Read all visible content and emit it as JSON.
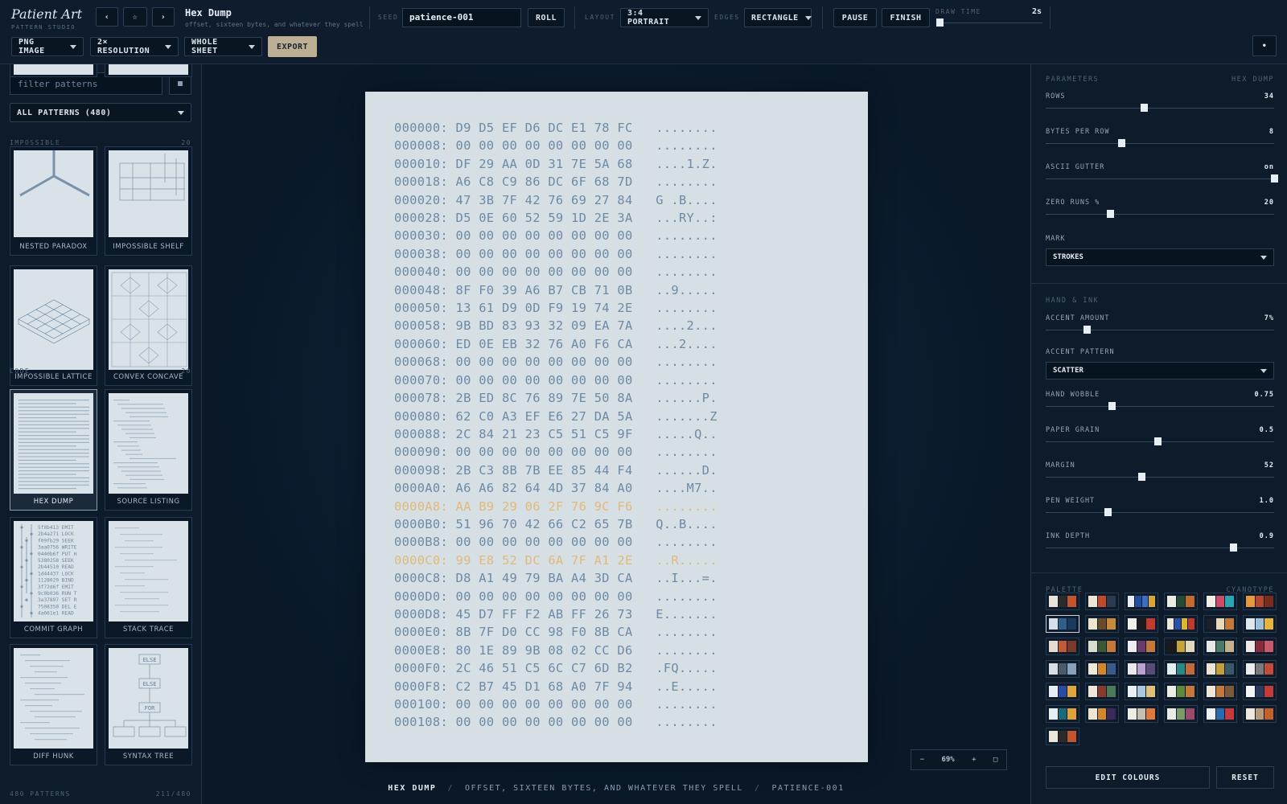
{
  "app": {
    "title": "Patient Art",
    "subtitle": "PATTERN STUDIO"
  },
  "toolbar": {
    "prev": "‹",
    "star": "☆",
    "next": "›",
    "pattern_title": "Hex Dump",
    "pattern_desc": "offset, sixteen bytes, and whatever they spell",
    "seed_label": "SEED",
    "seed_value": "patience-001",
    "roll": "ROLL",
    "layout_label": "LAYOUT",
    "layout_value": "3:4 PORTRAIT",
    "edges_label": "EDGES",
    "edges_value": "RECTANGLE",
    "pause": "PAUSE",
    "finish": "FINISH",
    "draw_time_label": "DRAW TIME",
    "draw_time_value": "2s",
    "draw_time_fraction": 0.02,
    "format": "PNG IMAGE",
    "resolution": "2× RESOLUTION",
    "scope": "WHOLE SHEET",
    "export": "EXPORT",
    "dot": "•"
  },
  "sidebar": {
    "filter_placeholder": "filter patterns",
    "filter_button_icon": "square-icon",
    "category": "ALL PATTERNS (480)",
    "sections": [
      {
        "name": "IMPOSSIBLE",
        "count": "20"
      },
      {
        "name": "CODE",
        "count": "20"
      }
    ],
    "thumbs": [
      {
        "label": "NESTED PARADOX"
      },
      {
        "label": "IMPOSSIBLE SHELF"
      },
      {
        "label": "IMPOSSIBLE LATTICE"
      },
      {
        "label": "CONVEX CONCAVE"
      },
      {
        "label": "HEX DUMP"
      },
      {
        "label": "SOURCE LISTING"
      },
      {
        "label": "COMMIT GRAPH"
      },
      {
        "label": "STACK TRACE"
      },
      {
        "label": "DIFF HUNK"
      },
      {
        "label": "SYNTAX TREE"
      }
    ],
    "commit_lines": [
      "5f0b413 EMIT",
      "2b4a271 LOCK",
      "f09fb29 SEEK",
      "3aa0756 WRITE",
      "0440b6f PUT H",
      "5380258 SEEK",
      "2b44510 READ",
      "1d44437 LOCK",
      "1128029 BIND",
      "3f72d6f EMIT",
      "9c0b036 RUN T",
      "3a37897 SET R",
      "7508350 DEL E",
      "4a661e1 READ"
    ],
    "tree_nodes": [
      "ELSE",
      "ELSE",
      "FOR"
    ],
    "footer_left": "480 PATTERNS",
    "footer_right": "211/480"
  },
  "hexdump": {
    "rows": [
      {
        "off": "000000:",
        "bytes": "D9 D5 EF D6 DC E1 78 FC",
        "ascii": "........"
      },
      {
        "off": "000008:",
        "bytes": "00 00 00 00 00 00 00 00",
        "ascii": "........"
      },
      {
        "off": "000010:",
        "bytes": "DF 29 AA 0D 31 7E 5A 68",
        "ascii": "....1.Z."
      },
      {
        "off": "000018:",
        "bytes": "A6 C8 C9 86 DC 6F 68 7D",
        "ascii": "........"
      },
      {
        "off": "000020:",
        "bytes": "47 3B 7F 42 76 69 27 84",
        "ascii": "G .B...."
      },
      {
        "off": "000028:",
        "bytes": "D5 0E 60 52 59 1D 2E 3A",
        "ascii": "...RY..:"
      },
      {
        "off": "000030:",
        "bytes": "00 00 00 00 00 00 00 00",
        "ascii": "........"
      },
      {
        "off": "000038:",
        "bytes": "00 00 00 00 00 00 00 00",
        "ascii": "........"
      },
      {
        "off": "000040:",
        "bytes": "00 00 00 00 00 00 00 00",
        "ascii": "........"
      },
      {
        "off": "000048:",
        "bytes": "8F F0 39 A6 B7 CB 71 0B",
        "ascii": "..9....."
      },
      {
        "off": "000050:",
        "bytes": "13 61 D9 0D F9 19 74 2E",
        "ascii": "........"
      },
      {
        "off": "000058:",
        "bytes": "9B BD 83 93 32 09 EA 7A",
        "ascii": "....2..."
      },
      {
        "off": "000060:",
        "bytes": "ED 0E EB 32 76 A0 F6 CA",
        "ascii": "...2...."
      },
      {
        "off": "000068:",
        "bytes": "00 00 00 00 00 00 00 00",
        "ascii": "........"
      },
      {
        "off": "000070:",
        "bytes": "00 00 00 00 00 00 00 00",
        "ascii": "........"
      },
      {
        "off": "000078:",
        "bytes": "2B ED 8C 76 89 7E 50 8A",
        "ascii": "......P."
      },
      {
        "off": "000080:",
        "bytes": "62 C0 A3 EF E6 27 DA 5A",
        "ascii": ".......Z"
      },
      {
        "off": "000088:",
        "bytes": "2C 84 21 23 C5 51 C5 9F",
        "ascii": ".....Q.."
      },
      {
        "off": "000090:",
        "bytes": "00 00 00 00 00 00 00 00",
        "ascii": "........"
      },
      {
        "off": "000098:",
        "bytes": "2B C3 8B 7B EE 85 44 F4",
        "ascii": "......D."
      },
      {
        "off": "0000A0:",
        "bytes": "A6 A6 82 64 4D 37 84 A0",
        "ascii": "....M7.."
      },
      {
        "off": "0000A8:",
        "bytes": "AA B9 29 06 2F 76 9C F6",
        "ascii": "........",
        "accent": true
      },
      {
        "off": "0000B0:",
        "bytes": "51 96 70 42 66 C2 65 7B",
        "ascii": "Q..B...."
      },
      {
        "off": "0000B8:",
        "bytes": "00 00 00 00 00 00 00 00",
        "ascii": "........"
      },
      {
        "off": "0000C0:",
        "bytes": "99 E8 52 DC 6A 7F A1 2E",
        "ascii": "..R.....",
        "accent": true
      },
      {
        "off": "0000C8:",
        "bytes": "D8 A1 49 79 BA A4 3D CA",
        "ascii": "..I...=."
      },
      {
        "off": "0000D0:",
        "bytes": "00 00 00 00 00 00 00 00",
        "ascii": "........"
      },
      {
        "off": "0000D8:",
        "bytes": "45 D7 FF F2 AB FF 26 73",
        "ascii": "E......."
      },
      {
        "off": "0000E0:",
        "bytes": "8B 7F D0 CC 98 F0 8B CA",
        "ascii": "........"
      },
      {
        "off": "0000E8:",
        "bytes": "80 1E 89 9B 08 02 CC D6",
        "ascii": "........"
      },
      {
        "off": "0000F0:",
        "bytes": "2C 46 51 C5 6C C7 6D B2",
        "ascii": ".FQ....."
      },
      {
        "off": "0000F8:",
        "bytes": "C2 B7 45 D1 68 A0 7F 94",
        "ascii": "..E....."
      },
      {
        "off": "000100:",
        "bytes": "00 00 00 00 00 00 00 00",
        "ascii": "........"
      },
      {
        "off": "000108:",
        "bytes": "00 00 00 00 00 00 00 00",
        "ascii": "........"
      }
    ]
  },
  "canvas": {
    "zoom_minus": "−",
    "zoom_value": "69%",
    "zoom_plus": "+",
    "fit_icon": "□",
    "caption_title": "HEX DUMP",
    "caption_desc": "OFFSET, SIXTEEN BYTES, AND WHATEVER THEY SPELL",
    "caption_seed": "PATIENCE-001",
    "sep": "/"
  },
  "params": {
    "section_title": "PARAMETERS",
    "section_name": "HEX DUMP",
    "items": [
      {
        "label": "ROWS",
        "value": "34",
        "fraction": 0.43
      },
      {
        "label": "BYTES PER ROW",
        "value": "8",
        "fraction": 0.33
      },
      {
        "label": "ASCII GUTTER",
        "value": "on",
        "fraction": 1.0
      },
      {
        "label": "ZERO RUNS %",
        "value": "20",
        "fraction": 0.28
      }
    ],
    "mark_label": "MARK",
    "mark_value": "STROKES",
    "hand_title": "HAND & INK",
    "accent_amount": {
      "label": "ACCENT AMOUNT",
      "value": "7%",
      "fraction": 0.18
    },
    "accent_pattern_label": "ACCENT PATTERN",
    "accent_pattern_value": "SCATTER",
    "items2": [
      {
        "label": "HAND WOBBLE",
        "value": "0.75",
        "fraction": 0.29
      },
      {
        "label": "PAPER GRAIN",
        "value": "0.5",
        "fraction": 0.49
      },
      {
        "label": "MARGIN",
        "value": "52",
        "fraction": 0.42
      },
      {
        "label": "PEN WEIGHT",
        "value": "1.0",
        "fraction": 0.27
      },
      {
        "label": "INK DEPTH",
        "value": "0.9",
        "fraction": 0.82
      }
    ]
  },
  "palette": {
    "title": "PALETTE",
    "name": "CYANOTYPE",
    "edit": "EDIT COLOURS",
    "reset": "RESET",
    "swatches": [
      [
        "#e8e4da",
        "#2a2a2a",
        "#c2552b"
      ],
      [
        "#efe6d4",
        "#c24a2a",
        "#2b3b52"
      ],
      [
        "#e8eef3",
        "#1f4fa0",
        "#3c6fc4",
        "#d9a53a"
      ],
      [
        "#ecebe4",
        "#234b34",
        "#c46a2e"
      ],
      [
        "#f1eee6",
        "#d04a6a",
        "#2aa6b0"
      ],
      [
        "#e49a3a",
        "#b8462a",
        "#7a2d1c"
      ],
      [
        "#d6e0ea",
        "#2f5f8a",
        "#1a3a5c"
      ],
      [
        "#efe6d0",
        "#6b4a2a",
        "#c7893a"
      ],
      [
        "#f3f0ea",
        "#1b1b1b",
        "#c23b2e"
      ],
      [
        "#ede8dc",
        "#2c52a8",
        "#e0b92a",
        "#c43a2a"
      ],
      [
        "#1d2028",
        "#e8d9b8",
        "#c4793a"
      ],
      [
        "#dfe8ef",
        "#9dc1dd",
        "#e8b440"
      ],
      [
        "#e7dccd",
        "#c25a3a",
        "#7a3a2a"
      ],
      [
        "#d9dfd0",
        "#3b5a34",
        "#c4793a"
      ],
      [
        "#f0ecef",
        "#6a3a6a",
        "#c4793a"
      ],
      [
        "#1a1a1a",
        "#c7a33a",
        "#e0d9c0"
      ],
      [
        "#e6ebe6",
        "#4a7a6a",
        "#c4b08a"
      ],
      [
        "#efe9e9",
        "#8a2a3a",
        "#c95a6a"
      ],
      [
        "#d8dde4",
        "#4a5a6a",
        "#8aa0b8"
      ],
      [
        "#f0e8d8",
        "#d4882a",
        "#3a5a8a"
      ],
      [
        "#ece8f0",
        "#b8a0d0",
        "#5a4a7a"
      ],
      [
        "#e6efef",
        "#2a8a8a",
        "#c46a3a"
      ],
      [
        "#eee6d4",
        "#c4a03a",
        "#3a5a6a"
      ],
      [
        "#ececec",
        "#7a7a7a",
        "#c44a3a"
      ],
      [
        "#e8edf3",
        "#2a4aa8",
        "#e0a83a"
      ],
      [
        "#efe6dc",
        "#8a3a2a",
        "#4a7a5a"
      ],
      [
        "#e8f0f4",
        "#a8c8e0",
        "#e0c07a"
      ],
      [
        "#ecefe6",
        "#5a8a3a",
        "#c4793a"
      ],
      [
        "#f0e6da",
        "#c4793a",
        "#7a5a3a"
      ],
      [
        "#f4f4f4",
        "#2a3a5a",
        "#c43a3a"
      ],
      [
        "#e6efef",
        "#1a6a7a",
        "#e0a03a"
      ],
      [
        "#ede6d4",
        "#d4882a",
        "#3a2a5a"
      ],
      [
        "#efece4",
        "#c4c0b0",
        "#e07a3a"
      ],
      [
        "#e8ece4",
        "#7a9a6a",
        "#9a4a6a"
      ],
      [
        "#eef2f4",
        "#2a6ab0",
        "#c43a3a"
      ],
      [
        "#f0e8dc",
        "#b89a7a",
        "#c4602a"
      ],
      [
        "#ede6da",
        "#2a2a2a",
        "#c2552b"
      ]
    ]
  }
}
